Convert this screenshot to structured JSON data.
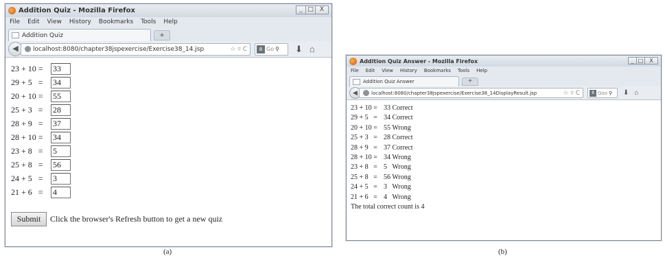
{
  "window_a": {
    "title": "Addition Quiz - Mozilla Firefox",
    "menu": [
      "File",
      "Edit",
      "View",
      "History",
      "Bookmarks",
      "Tools",
      "Help"
    ],
    "tab_title": "Addition Quiz",
    "new_tab": "+",
    "url": "localhost:8080/chapter38jspexercise/Exercise38_14.jsp",
    "search_placeholder": "Go",
    "questions": [
      {
        "expr": "23 + 10 =",
        "answer": "33"
      },
      {
        "expr": "29 + 5   =",
        "answer": "34"
      },
      {
        "expr": "20 + 10 =",
        "answer": "55"
      },
      {
        "expr": "25 + 3   =",
        "answer": "28"
      },
      {
        "expr": "28 + 9   =",
        "answer": "37"
      },
      {
        "expr": "28 + 10 =",
        "answer": "34"
      },
      {
        "expr": "23 + 8   =",
        "answer": "5"
      },
      {
        "expr": "25 + 8   =",
        "answer": "56"
      },
      {
        "expr": "24 + 5   =",
        "answer": "3"
      },
      {
        "expr": "21 + 6   =",
        "answer": "4"
      }
    ],
    "submit_label": "Submit",
    "hint": "Click the browser's Refresh button to get a new quiz"
  },
  "window_b": {
    "title": "Addition Quiz Answer - Mozilla Firefox",
    "menu": [
      "File",
      "Edit",
      "View",
      "History",
      "Bookmarks",
      "Tools",
      "Help"
    ],
    "tab_title": "Addition Quiz Answer",
    "new_tab": "+",
    "url": "localhost:8080/chapter38jspexercise/Exercise38_14DisplayResult.jsp",
    "search_placeholder": "Goo",
    "results": [
      {
        "expr": "23 + 10 =",
        "result": "33 Correct"
      },
      {
        "expr": "29 + 5   =",
        "result": "34 Correct"
      },
      {
        "expr": "20 + 10 =",
        "result": "55 Wrong"
      },
      {
        "expr": "25 + 3   =",
        "result": "28 Correct"
      },
      {
        "expr": "28 + 9   =",
        "result": "37 Correct"
      },
      {
        "expr": "28 + 10 =",
        "result": "34 Wrong"
      },
      {
        "expr": "23 + 8   =",
        "result": "5   Wrong"
      },
      {
        "expr": "25 + 8   =",
        "result": "56 Wrong"
      },
      {
        "expr": "24 + 5   =",
        "result": "3   Wrong"
      },
      {
        "expr": "21 + 6   =",
        "result": "4   Wrong"
      }
    ],
    "total": "The total correct count is 4"
  },
  "captions": {
    "a": "(a)",
    "b": "(b)"
  },
  "window_controls": {
    "minimize": "_",
    "maximize": "□",
    "close": "X"
  }
}
